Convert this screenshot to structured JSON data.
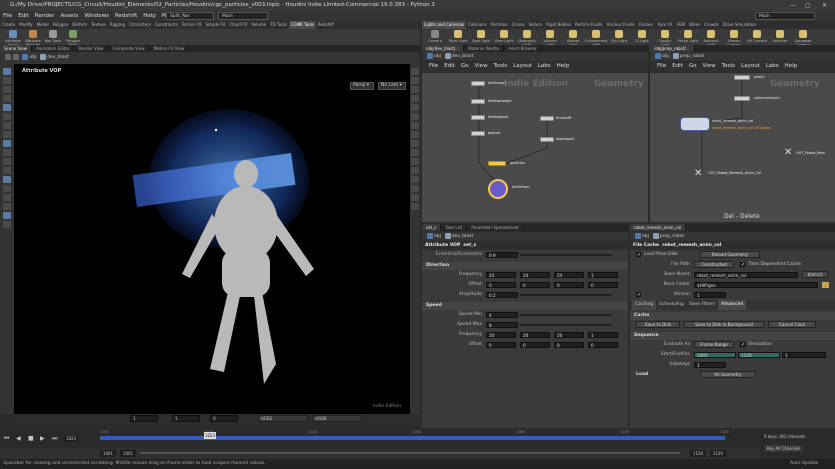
{
  "window": {
    "title": "G:/My Drive/PROJECTS/CG_Circuit/Houdini_Elements/02_Particles/Houdini/cgc_particles_v003.hiplc - Houdini Indie Limited-Commercial 19.0.383 - Python 3",
    "min": "—",
    "max": "▢",
    "close": "✕"
  },
  "menu": {
    "items": [
      "File",
      "Edit",
      "Render",
      "Assets",
      "Windows",
      "Redshift",
      "Help",
      "Prism"
    ],
    "desktop1": "Split_Nor",
    "desktop2": "Main",
    "desktop3": "Main"
  },
  "shelf_tabs_left": [
    "Create",
    "Modify",
    "Model",
    "Polygon",
    "Deform",
    "Texture",
    "Rigging",
    "Characters",
    "Constraints",
    "Terrain FX",
    "Simple FX",
    "Cloud FX",
    "Volume",
    "TD Tools",
    "CGMK Tools",
    "Redshift"
  ],
  "shelf_tabs_right": [
    "Lights and Cameras",
    "Collisions",
    "Particles",
    "Grains",
    "Vellum",
    "Rigid Bodies",
    "Particle Fluids",
    "Viscous Fluids",
    "Oceans",
    "Pyro FX",
    "FEM",
    "Wires",
    "Crowds",
    "Drive Simulation"
  ],
  "shelf_tools_left": [
    "Attribute Adjust",
    "Attribute Wrangle",
    "Box Tools",
    "Polygon Tools"
  ],
  "shelf_tools_right": [
    "Camera",
    "Point Light",
    "Spot Light",
    "Area Light",
    "Geometry Light",
    "Volume Light",
    "Distant Light",
    "Environment Light",
    "Sky Light",
    "GI Light",
    "Caustic Light",
    "Portal Light",
    "Ambient Light",
    "Stereo Camera",
    "VR Camera",
    "Switcher",
    "Gamepad Camera"
  ],
  "viewer": {
    "tabs": [
      "Scene View",
      "Animation Editor",
      "Render View",
      "Composite View",
      "Motion FX View"
    ],
    "path_root": "obj",
    "path_node": "dev_blast",
    "title": "Attribute VOP",
    "persp": "Persp ▾",
    "cam": "No cam ▾",
    "bottom_label": "Indie Edition",
    "frame_a": "1",
    "frame_b": "1",
    "frame_c": "0",
    "colorspace": "ACES",
    "display": "sRGB"
  },
  "timeline": {
    "current": "1023",
    "start": "1001",
    "start2": "1001",
    "end": "1120",
    "end2": "1120",
    "ticks": [
      "1001",
      "1020",
      "1040",
      "1060",
      "1080",
      "1100",
      "1120"
    ],
    "keys_label": "0 keys, 0/0 channels",
    "key_all": "Key All Channels",
    "auto_update": "Auto Update",
    "fps_note": "Spacebar for viewing and unrestricted scrubbing. Middle mouse drag on frame slider to hold scoped channel values."
  },
  "net_left": {
    "tabs": [
      "/obj/dev_blast/...",
      "Material Palette",
      "Asset Browser"
    ],
    "path_root": "obj",
    "path_node": "dev_blast",
    "menu": [
      "File",
      "Edit",
      "Go",
      "View",
      "Tools",
      "Layout",
      "Labs",
      "Help"
    ],
    "watermark": "Indie Edition",
    "context": "Geometry",
    "nodes": [
      "attribvop1",
      "attribwrangle",
      "attribadjust",
      "popnet",
      "timeshift",
      "dopimport",
      "particles",
      "attribfrom"
    ]
  },
  "net_right": {
    "tabs": [
      "/obj/prep_robot/..."
    ],
    "path_root": "obj",
    "path_node": "prep_robot",
    "menu": [
      "File",
      "Edit",
      "Go",
      "View",
      "Tools",
      "Layout",
      "Labs",
      "Help"
    ],
    "context": "Geometry",
    "nodes": [
      "peak1",
      "coloremission1",
      "robot_remesh_anim_col",
      "OUT_Robot_Remesh_Anim_Col",
      "OUT_Robot_Rem"
    ],
    "node_sub": "robot_remesh_anim_col.$F4.bgeo",
    "hint": "Del - Delete"
  },
  "parm_left": {
    "tabs": [
      "set_s",
      "Take List",
      "Parameter Spreadsheet"
    ],
    "path_root": "obj",
    "path_node": "dev_blast",
    "node_type": "Attribute VOP",
    "node_name": "set_s",
    "rows": [
      {
        "label": "Eccentric/Concentric",
        "v": [
          "0.9"
        ]
      },
      {
        "section": "Direction"
      },
      {
        "label": "Frequency",
        "v": [
          "24",
          "24",
          "24",
          "1"
        ]
      },
      {
        "label": "Offset",
        "v": [
          "0",
          "0",
          "0",
          "0"
        ]
      },
      {
        "label": "Amplitude",
        "v": [
          "0.2"
        ]
      },
      {
        "section": "Speed"
      },
      {
        "label": "Speed Min",
        "v": [
          "4"
        ]
      },
      {
        "label": "Speed Max",
        "v": [
          "8"
        ]
      },
      {
        "label": "Frequency",
        "v": [
          "20",
          "20",
          "20",
          "1"
        ]
      },
      {
        "label": "Offset",
        "v": [
          "0",
          "0",
          "0",
          "0"
        ]
      }
    ]
  },
  "parm_right": {
    "tabs": [
      "robot_remesh_anim_col"
    ],
    "path_root": "obj",
    "path_node": "prep_robot",
    "node_type": "File Cache",
    "node_name": "robot_remesh_anim_col",
    "load_from_disk": "Load from Disk",
    "reload": "Reload Geometry",
    "file_path_label": "File Path",
    "file_path": "Constructed",
    "time_dep": "Time Dependent Cache",
    "base_name_label": "Base Name",
    "base_name": "robot_remesh_anim_col",
    "sign_in": "$(sn:n)",
    "base_folder_label": "Base Folder",
    "base_folder": "$HIP/geo",
    "version_label": "Version",
    "version": "1",
    "subtabs": [
      "Caching",
      "Scheduling",
      "Save Filters",
      "Advanced"
    ],
    "cache_section": "Cache",
    "save_disk": "Save to Disk",
    "save_bg": "Save to Disk in Background",
    "cancel": "Cancel Cook",
    "seq_section": "Sequence",
    "evaluate_label": "Evaluate As",
    "evaluate": "Frame Range",
    "simulation": "Simulation",
    "startend_label": "Start/End/Inc",
    "start": "1001",
    "end": "1120",
    "inc": "1",
    "substeps_label": "Substeps",
    "substeps": "1",
    "load_section": "Load",
    "all_geo": "All Geometry"
  },
  "colors": {
    "accent": "#f0a030",
    "particle": "#3a8cff",
    "selected": "#ffd24a"
  }
}
